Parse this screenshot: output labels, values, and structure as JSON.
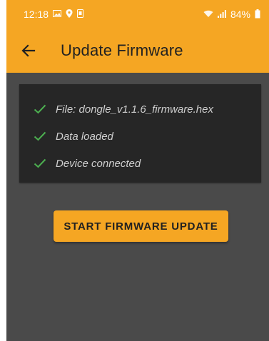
{
  "status_bar": {
    "time": "12:18",
    "battery": "84%",
    "left_icons": [
      "image-icon",
      "location-icon",
      "device-icon"
    ],
    "right_icons": [
      "wifi-icon",
      "signal-icon",
      "battery-icon"
    ]
  },
  "app_bar": {
    "title": "Update Firmware",
    "back_icon": "back-arrow-icon"
  },
  "status_card": {
    "items": [
      {
        "label": "File:  dongle_v1.1.6_firmware.hex",
        "icon": "check-icon"
      },
      {
        "label": "Data loaded",
        "icon": "check-icon"
      },
      {
        "label": "Device connected",
        "icon": "check-icon"
      }
    ]
  },
  "actions": {
    "start_button": "START FIRMWARE UPDATE"
  },
  "colors": {
    "accent": "#f5a623",
    "background": "#4a4a4a",
    "card": "#262626",
    "check": "#4caf50",
    "text_muted": "#cfcfcf"
  }
}
